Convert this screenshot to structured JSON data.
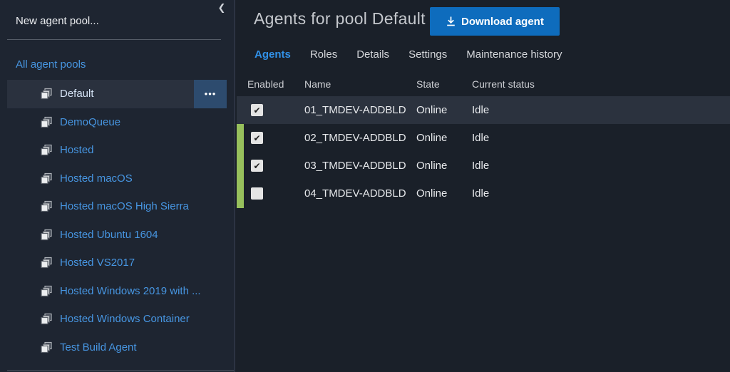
{
  "sidebar": {
    "new_pool_label": "New agent pool...",
    "all_pools_label": "All agent pools",
    "collapse_glyph": "❮",
    "ellipsis_glyph": "•••",
    "pools": [
      "Default",
      "DemoQueue",
      "Hosted",
      "Hosted macOS",
      "Hosted macOS High Sierra",
      "Hosted Ubuntu 1604",
      "Hosted VS2017",
      "Hosted Windows 2019 with ...",
      "Hosted Windows Container",
      "Test Build Agent"
    ],
    "selected_pool": "Default"
  },
  "header": {
    "title": "Agents for pool Default",
    "download_button_label": "Download agent"
  },
  "tabs": [
    {
      "label": "Agents",
      "active": true
    },
    {
      "label": "Roles",
      "active": false
    },
    {
      "label": "Details",
      "active": false
    },
    {
      "label": "Settings",
      "active": false
    },
    {
      "label": "Maintenance history",
      "active": false
    }
  ],
  "table": {
    "columns": [
      "Enabled",
      "Name",
      "State",
      "Current status"
    ],
    "rows": [
      {
        "enabled": true,
        "name": "01_TMDEV-ADDBLD",
        "state": "Online",
        "status": "Idle",
        "highlighted": true
      },
      {
        "enabled": true,
        "name": "02_TMDEV-ADDBLD",
        "state": "Online",
        "status": "Idle",
        "highlighted": false
      },
      {
        "enabled": true,
        "name": "03_TMDEV-ADDBLD",
        "state": "Online",
        "status": "Idle",
        "highlighted": false
      },
      {
        "enabled": false,
        "name": "04_TMDEV-ADDBLD",
        "state": "Online",
        "status": "Idle",
        "highlighted": false
      }
    ]
  },
  "colors": {
    "accent_blue": "#0e6cbd",
    "link_blue": "#4796e2",
    "active_tab_blue": "#3191e8",
    "green_accent": "#97c05c",
    "sidebar_bg": "#1e2531",
    "main_bg": "#1a2029",
    "row_highlight": "#2b323e"
  }
}
